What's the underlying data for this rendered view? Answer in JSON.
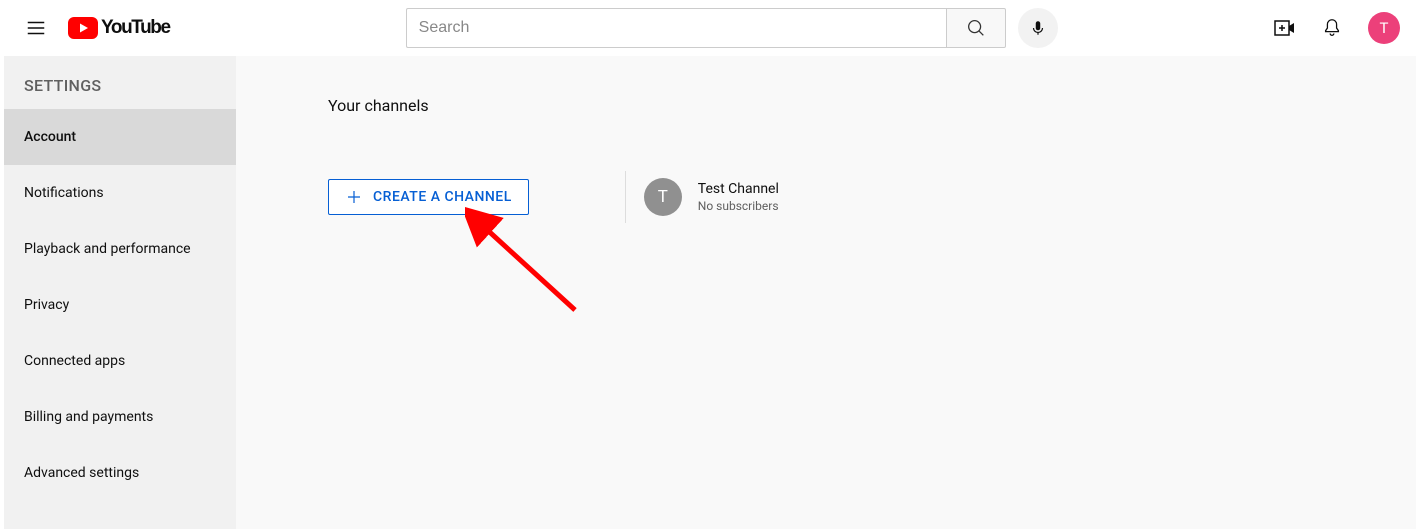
{
  "header": {
    "logo_text": "YouTube",
    "search_placeholder": "Search",
    "avatar_letter": "T"
  },
  "sidebar": {
    "title": "SETTINGS",
    "items": [
      {
        "label": "Account",
        "active": true
      },
      {
        "label": "Notifications",
        "active": false
      },
      {
        "label": "Playback and performance",
        "active": false
      },
      {
        "label": "Privacy",
        "active": false
      },
      {
        "label": "Connected apps",
        "active": false
      },
      {
        "label": "Billing and payments",
        "active": false
      },
      {
        "label": "Advanced settings",
        "active": false
      }
    ]
  },
  "main": {
    "title": "Your channels",
    "create_button_label": "CREATE A CHANNEL",
    "channels": [
      {
        "avatar_letter": "T",
        "name": "Test Channel",
        "subs": "No subscribers"
      }
    ]
  },
  "colors": {
    "brand_red": "#ff0000",
    "link_blue": "#065fd4",
    "avatar_pink": "#ec407a",
    "sidebar_bg": "#f1f1f1",
    "active_bg": "#d9d9d9"
  }
}
